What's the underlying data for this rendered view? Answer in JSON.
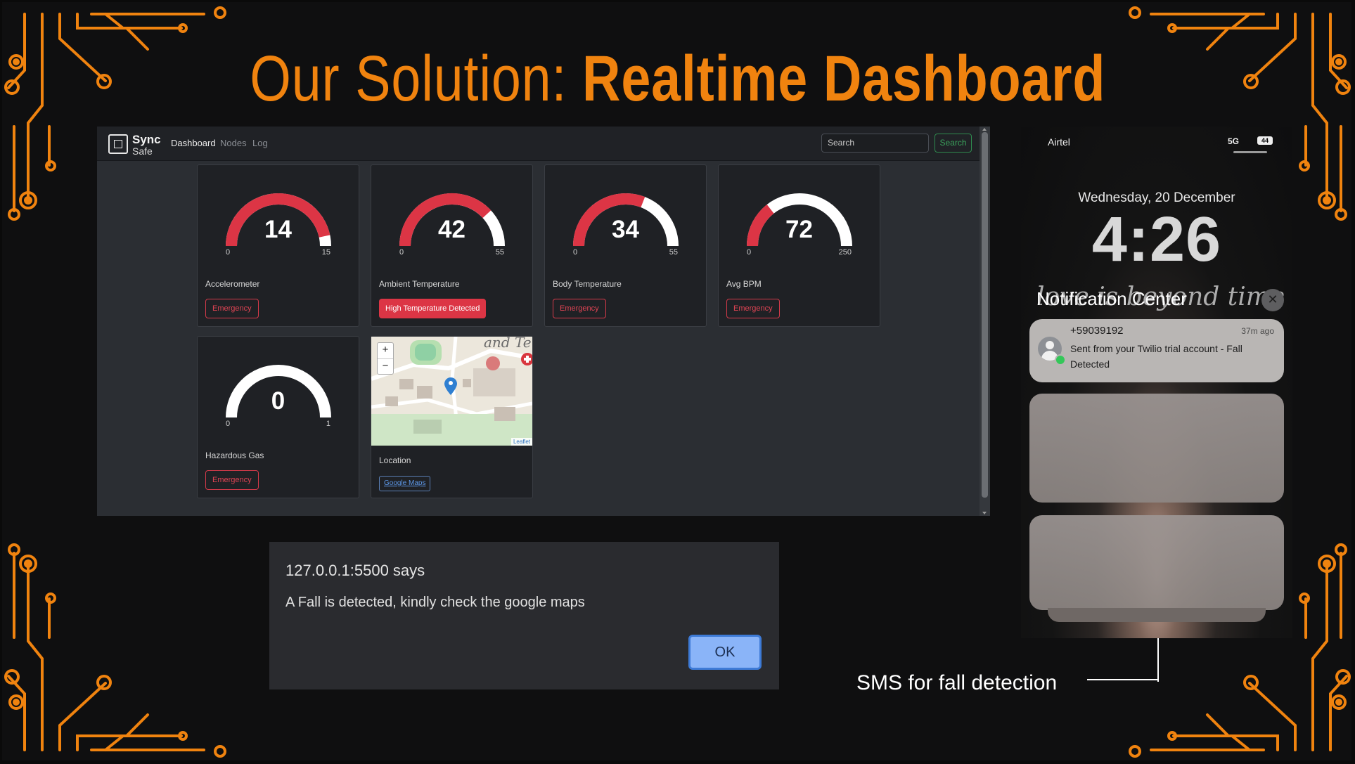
{
  "slide": {
    "title_regular": "Our Solution: ",
    "title_bold": "Realtime Dashboard",
    "accent_color": "#f0830f"
  },
  "dashboard": {
    "brand": {
      "line1": "Sync",
      "line2": "Safe",
      "icon": "chip-logo-icon"
    },
    "nav": [
      "Dashboard",
      "Nodes",
      "Log"
    ],
    "active_nav": "Dashboard",
    "search": {
      "placeholder": "Search",
      "button": "Search"
    },
    "cards": [
      {
        "label": "Accelerometer",
        "value": 14,
        "min": 0,
        "max": 15,
        "button": "Emergency",
        "button_state": "outline"
      },
      {
        "label": "Ambient Temperature",
        "value": 42,
        "min": 0,
        "max": 55,
        "button": "High Temperature Detected",
        "button_state": "filled"
      },
      {
        "label": "Body Temperature",
        "value": 34,
        "min": 0,
        "max": 55,
        "button": "Emergency",
        "button_state": "outline"
      },
      {
        "label": "Avg BPM",
        "value": 72,
        "min": 0,
        "max": 250,
        "button": "Emergency",
        "button_state": "outline"
      },
      {
        "label": "Hazardous Gas",
        "value": 0,
        "min": 0,
        "max": 1,
        "button": "Emergency",
        "button_state": "outline"
      }
    ],
    "location": {
      "label": "Location",
      "link": "Google Maps",
      "map_attribution": "Leaflet",
      "map_text": "and Te",
      "zoom_in": "+",
      "zoom_out": "−"
    },
    "colors": {
      "gauge_fill": "#dc3545",
      "gauge_empty": "#ffffff",
      "alert": "#dc3545"
    }
  },
  "dialog": {
    "origin": "127.0.0.1:5500 says",
    "message": "A Fall is detected, kindly check the google maps",
    "ok": "OK"
  },
  "phone": {
    "carrier": "Airtel",
    "network": "5G",
    "battery": "44",
    "date": "Wednesday, 20 December",
    "time": "4:26",
    "wallpaper_text": "love is beyond time",
    "notification_center": "Notification Center",
    "notification": {
      "sender": "+59039192",
      "time": "37m ago",
      "body": "Sent from your Twilio trial account - Fall Detected"
    }
  },
  "caption": "SMS for fall detection"
}
